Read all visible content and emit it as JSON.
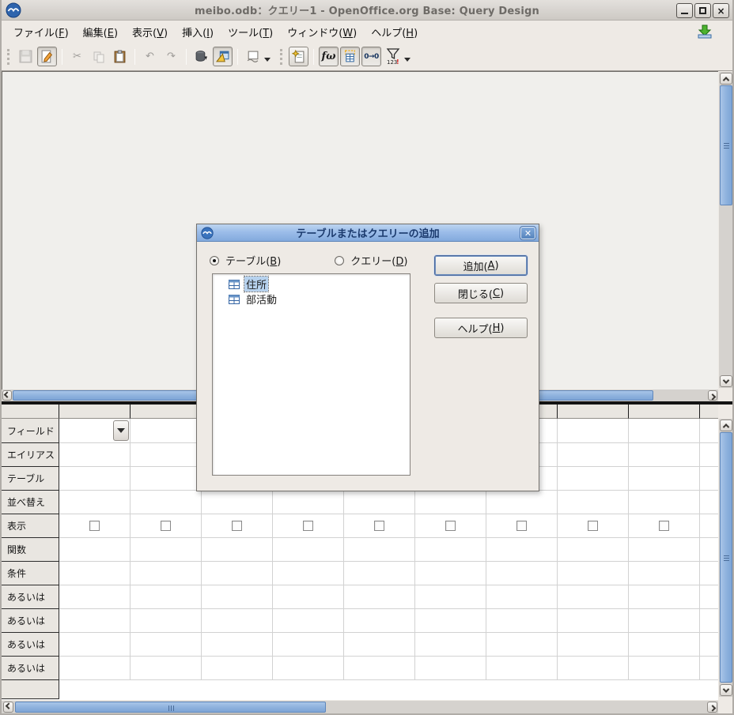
{
  "window": {
    "title": "meibo.odb：クエリー1 - OpenOffice.org Base: Query Design"
  },
  "menubar": {
    "items": [
      {
        "label": "ファイル(F)"
      },
      {
        "label": "編集(E)"
      },
      {
        "label": "表示(V)"
      },
      {
        "label": "挿入(I)"
      },
      {
        "label": "ツール(T)"
      },
      {
        "label": "ウィンドウ(W)"
      },
      {
        "label": "ヘルプ(H)"
      }
    ]
  },
  "toolbar": {
    "functions_label": "fω",
    "alias_label": "0→0",
    "distinct_label": "123",
    "distinct_bang": "!"
  },
  "dialog": {
    "title": "テーブルまたはクエリーの追加",
    "radio_tables": "テーブル(B)",
    "radio_queries": "クエリー(D)",
    "tables": [
      {
        "name": "住所",
        "selected": true
      },
      {
        "name": "部活動",
        "selected": false
      }
    ],
    "buttons": {
      "add": "追加(A)",
      "close": "閉じる(C)",
      "help": "ヘルプ(H)"
    }
  },
  "grid": {
    "num_columns": 10,
    "checkbox_count": 9,
    "rows": [
      {
        "label": "フィールド",
        "kind": "field"
      },
      {
        "label": "エイリアス",
        "kind": "plain"
      },
      {
        "label": "テーブル",
        "kind": "plain"
      },
      {
        "label": "並べ替え",
        "kind": "plain"
      },
      {
        "label": "表示",
        "kind": "checkbox"
      },
      {
        "label": "関数",
        "kind": "plain"
      },
      {
        "label": "条件",
        "kind": "plain"
      },
      {
        "label": "あるいは",
        "kind": "plain"
      },
      {
        "label": "あるいは",
        "kind": "plain"
      },
      {
        "label": "あるいは",
        "kind": "plain"
      },
      {
        "label": "あるいは",
        "kind": "plain"
      }
    ]
  },
  "colors": {
    "accent_blue": "#3465a4",
    "selection_bg": "#b7d2ee",
    "dialog_titlebar": "#9cbde9",
    "scrollbar_thumb": "#8db1dd",
    "window_chrome": "#eeeae5"
  }
}
